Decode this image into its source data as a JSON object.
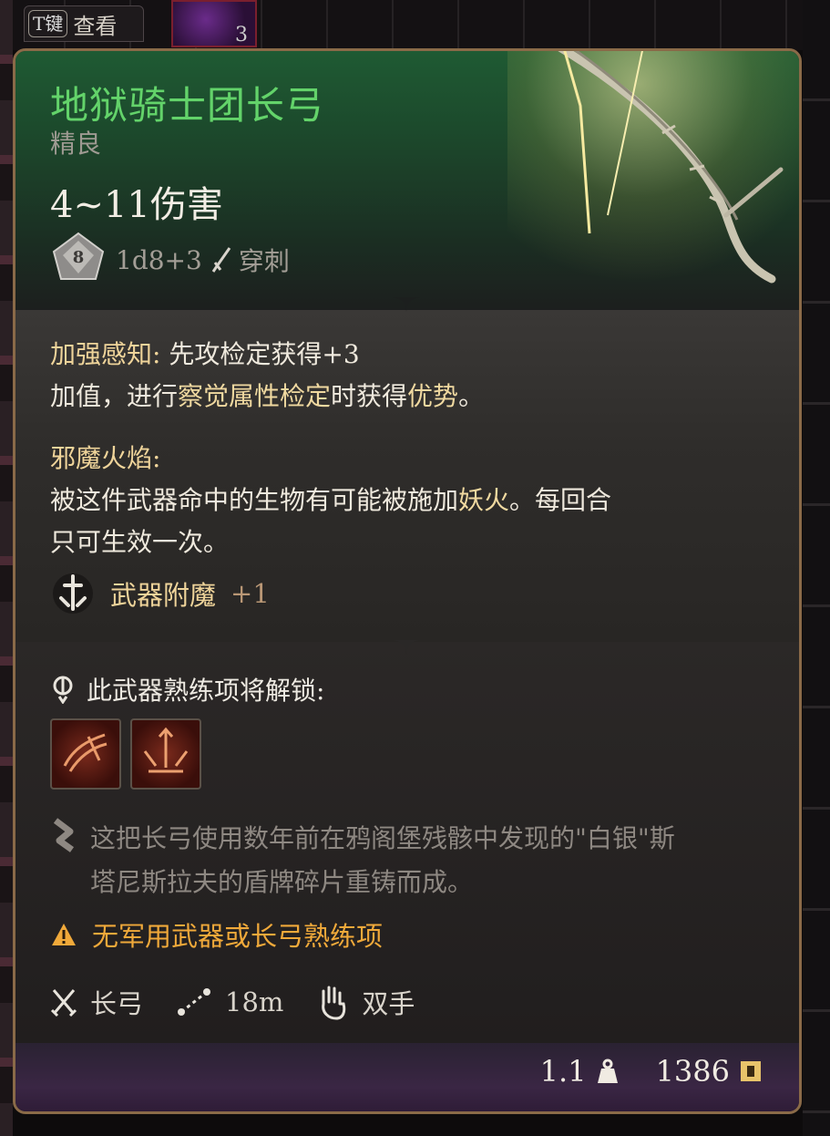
{
  "top_bar": {
    "key_label": "T键",
    "hint": "查看",
    "slot_count": "3"
  },
  "item": {
    "name": "地狱骑士团长弓",
    "rarity": "精良",
    "damage": "4~11伤害",
    "dice_face": "8",
    "dice_formula": "1d8+3",
    "damage_type": "穿刺"
  },
  "enchantments": {
    "perception_title": "加强感知",
    "perception_line1": "先攻检定获得+3",
    "perception_line2_pre": "加值，进行",
    "perception_line2_hl": "察觉属性检定",
    "perception_line2_mid": "时获得",
    "perception_line2_hl2": "优势",
    "perception_line2_end": "。",
    "fiend_title": "邪魔火焰:",
    "fiend_line1_pre": "被这件武器命中的生物有可能被施加",
    "fiend_line1_hl": "妖火",
    "fiend_line1_end": "。每回合",
    "fiend_line2": "只可生效一次。",
    "weapon_enchant_label": "武器附魔",
    "weapon_enchant_value": "+1"
  },
  "proficiency": {
    "unlock_label": "此武器熟练项将解锁:",
    "icons": [
      "proficiency-action-icon-1",
      "proficiency-action-icon-2"
    ]
  },
  "lore": {
    "line1": "这把长弓使用数年前在鸦阁堡残骸中发现的\"白银\"斯",
    "line2": "塔尼斯拉夫的盾牌碎片重铸而成。"
  },
  "warning": "无军用武器或长弓熟练项",
  "properties": {
    "weapon_type": "长弓",
    "range": "18m",
    "handedness": "双手"
  },
  "footer": {
    "weight": "1.1",
    "value": "1386"
  },
  "colors": {
    "title_green": "#63d36a",
    "gold": "#efd49a",
    "warning": "#f0a93a",
    "border": "#8a6a48"
  }
}
